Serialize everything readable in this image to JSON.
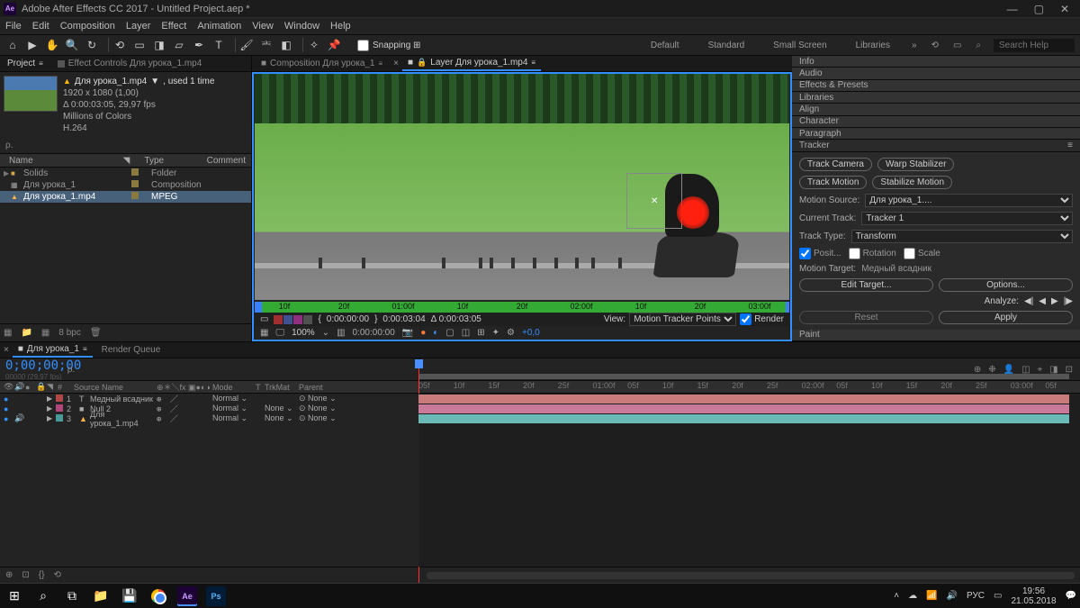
{
  "app": {
    "title": "Adobe After Effects CC 2017 - Untitled Project.aep *",
    "logo": "Ae"
  },
  "menu": [
    "File",
    "Edit",
    "Composition",
    "Layer",
    "Effect",
    "Animation",
    "View",
    "Window",
    "Help"
  ],
  "toolbar": {
    "snapping": "Snapping",
    "workspaces": [
      "Default",
      "Standard",
      "Small Screen",
      "Libraries"
    ],
    "search_placeholder": "Search Help"
  },
  "project_panel": {
    "tabs": {
      "project": "Project",
      "fx": "Effect Controls Для урока_1.mp4"
    },
    "item": {
      "name": "Для урока_1.mp4",
      "usage": ", used 1 time",
      "line2": "1920 x 1080 (1,00)",
      "line3": "Δ 0:00:03:05, 29,97 fps",
      "line4": "Millions of Colors",
      "line5": "H.264"
    },
    "search": "ρ.",
    "headers": {
      "name": "Name",
      "type": "Type",
      "comment": "Comment"
    },
    "rows": [
      {
        "name": "Solids",
        "type": "Folder",
        "icon": "folder"
      },
      {
        "name": "Для урока_1",
        "type": "Composition",
        "icon": "comp"
      },
      {
        "name": "Для урока_1.mp4",
        "type": "MPEG",
        "icon": "mpeg",
        "selected": true
      }
    ],
    "footer_bpc": "8 bpc"
  },
  "comp_panel": {
    "tabs": {
      "comp": "Composition Для урока_1",
      "layer": "Layer Для урока_1.mp4"
    },
    "mini_ticks": [
      "10f",
      "20f",
      "01:00f",
      "10f",
      "20f",
      "02:00f",
      "10f",
      "20f",
      "03:00f"
    ],
    "tracker_bar": {
      "tc_start": "0:00:00:00",
      "tc_end": "0:00:03:04",
      "tc_dur": "Δ 0:00:03:05",
      "view": "View:",
      "dropdown": "Motion Tracker Points",
      "render": "Render"
    },
    "footer": {
      "zoom": "100%",
      "timecode": "0:00:00:00",
      "exposure": "+0,0"
    }
  },
  "right": {
    "panels": [
      "Info",
      "Audio",
      "Effects & Presets",
      "Libraries",
      "Align",
      "Character",
      "Paragraph"
    ],
    "tracker": {
      "title": "Tracker",
      "btn_camera": "Track Camera",
      "btn_warp": "Warp Stabilizer",
      "btn_motion": "Track Motion",
      "btn_stab": "Stabilize Motion",
      "motion_source_lbl": "Motion Source:",
      "motion_source": "Для урока_1....",
      "current_track_lbl": "Current Track:",
      "current_track": "Tracker 1",
      "track_type_lbl": "Track Type:",
      "track_type": "Transform",
      "chk_pos": "Posit...",
      "chk_rot": "Rotation",
      "chk_scale": "Scale",
      "motion_target_lbl": "Motion Target:",
      "motion_target": "Медный всадник",
      "btn_edit": "Edit Target...",
      "btn_options": "Options...",
      "analyze_lbl": "Analyze:",
      "btn_reset": "Reset",
      "btn_apply": "Apply"
    },
    "paint": "Paint"
  },
  "timeline": {
    "tabs": {
      "comp": "Для урока_1",
      "rq": "Render Queue"
    },
    "timecode": "0;00;00;00",
    "sub": "00000 (29,97 fps)",
    "cols": {
      "src": "Source Name",
      "mode": "Mode",
      "trk": "TrkMat",
      "par": "Parent"
    },
    "ruler": [
      "05f",
      "10f",
      "15f",
      "20f",
      "25f",
      "01:00f",
      "05f",
      "10f",
      "15f",
      "20f",
      "25f",
      "02:00f",
      "05f",
      "10f",
      "15f",
      "20f",
      "25f",
      "03:00f",
      "05f"
    ],
    "layers": [
      {
        "n": "1",
        "name": "Медный всадник",
        "icon": "T",
        "mode": "Normal",
        "trk": "",
        "par": "None",
        "lbl": "red"
      },
      {
        "n": "2",
        "name": "Null 2",
        "icon": "■",
        "mode": "Normal",
        "trk": "None",
        "par": "None",
        "lbl": "pink"
      },
      {
        "n": "3",
        "name": "Для урока_1.mp4",
        "icon": "▲",
        "mode": "Normal",
        "trk": "None",
        "par": "None",
        "lbl": "teal"
      }
    ]
  },
  "taskbar": {
    "lang": "РУС",
    "time": "19:56",
    "date": "21.05.2018"
  }
}
